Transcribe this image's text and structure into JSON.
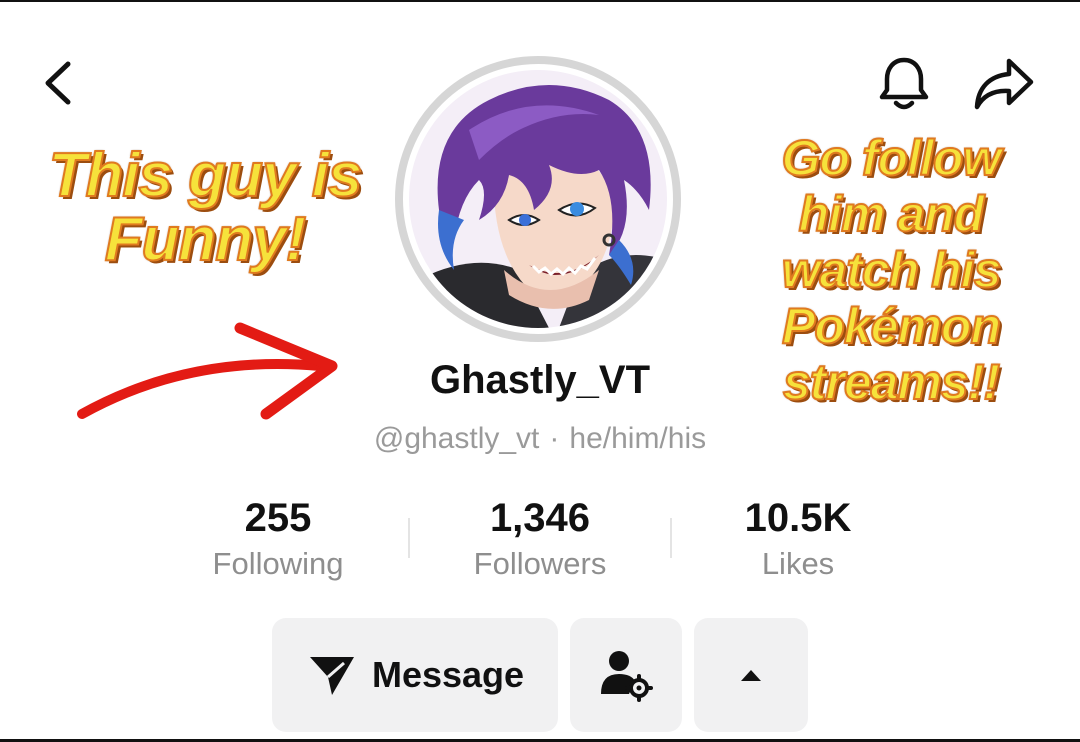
{
  "header": {
    "back_icon": "chevron-left-icon",
    "notification_icon": "bell-icon",
    "share_icon": "share-arrow-icon"
  },
  "profile": {
    "display_name": "Ghastly_VT",
    "handle": "@ghastly_vt",
    "separator": "·",
    "pronouns": "he/him/his",
    "avatar_icon": "anime-avatar"
  },
  "annotations": {
    "left_caption": [
      "This guy is",
      "Funny!"
    ],
    "right_caption": [
      "Go follow",
      "him and",
      "watch his",
      "Pokémon",
      "streams!!"
    ],
    "caption_color": "#f6e23b",
    "arrow_color": "#e31b14"
  },
  "stats": [
    {
      "value": "255",
      "label": "Following"
    },
    {
      "value": "1,346",
      "label": "Followers"
    },
    {
      "value": "10.5K",
      "label": "Likes"
    }
  ],
  "actions": {
    "message_label": "Message",
    "message_icon": "send-icon",
    "person_settings_icon": "person-gear-icon",
    "more_icon": "caret-up-icon"
  }
}
